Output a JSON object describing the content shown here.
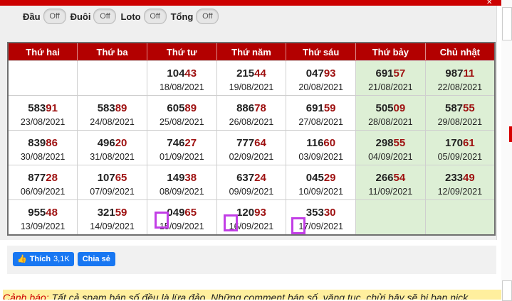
{
  "toggles": [
    {
      "label": "Đầu",
      "state": "Off"
    },
    {
      "label": "Đuôi",
      "state": "Off"
    },
    {
      "label": "Loto",
      "state": "Off"
    },
    {
      "label": "Tổng",
      "state": "Off"
    }
  ],
  "calendar": {
    "headers": [
      "Thứ hai",
      "Thứ ba",
      "Thứ tư",
      "Thứ năm",
      "Thứ sáu",
      "Thứ bảy",
      "Chủ nhật"
    ],
    "rows": [
      [
        {
          "head": "",
          "tail": "",
          "date": ""
        },
        {
          "head": "",
          "tail": "",
          "date": ""
        },
        {
          "head": "104",
          "tail": "43",
          "date": "18/08/2021"
        },
        {
          "head": "215",
          "tail": "44",
          "date": "19/08/2021"
        },
        {
          "head": "047",
          "tail": "93",
          "date": "20/08/2021"
        },
        {
          "head": "691",
          "tail": "57",
          "date": "21/08/2021"
        },
        {
          "head": "987",
          "tail": "11",
          "date": "22/08/2021"
        }
      ],
      [
        {
          "head": "583",
          "tail": "91",
          "date": "23/08/2021"
        },
        {
          "head": "583",
          "tail": "89",
          "date": "24/08/2021"
        },
        {
          "head": "605",
          "tail": "89",
          "date": "25/08/2021"
        },
        {
          "head": "886",
          "tail": "78",
          "date": "26/08/2021"
        },
        {
          "head": "691",
          "tail": "59",
          "date": "27/08/2021"
        },
        {
          "head": "505",
          "tail": "09",
          "date": "28/08/2021"
        },
        {
          "head": "587",
          "tail": "55",
          "date": "29/08/2021"
        }
      ],
      [
        {
          "head": "839",
          "tail": "86",
          "date": "30/08/2021"
        },
        {
          "head": "496",
          "tail": "20",
          "date": "31/08/2021"
        },
        {
          "head": "746",
          "tail": "27",
          "date": "01/09/2021"
        },
        {
          "head": "777",
          "tail": "64",
          "date": "02/09/2021"
        },
        {
          "head": "116",
          "tail": "60",
          "date": "03/09/2021"
        },
        {
          "head": "298",
          "tail": "55",
          "date": "04/09/2021"
        },
        {
          "head": "170",
          "tail": "61",
          "date": "05/09/2021"
        }
      ],
      [
        {
          "head": "877",
          "tail": "28",
          "date": "06/09/2021"
        },
        {
          "head": "107",
          "tail": "65",
          "date": "07/09/2021"
        },
        {
          "head": "149",
          "tail": "38",
          "date": "08/09/2021"
        },
        {
          "head": "637",
          "tail": "24",
          "date": "09/09/2021"
        },
        {
          "head": "045",
          "tail": "29",
          "date": "10/09/2021"
        },
        {
          "head": "266",
          "tail": "54",
          "date": "11/09/2021"
        },
        {
          "head": "233",
          "tail": "49",
          "date": "12/09/2021"
        }
      ],
      [
        {
          "head": "955",
          "tail": "48",
          "date": "13/09/2021"
        },
        {
          "head": "321",
          "tail": "59",
          "date": "14/09/2021"
        },
        {
          "head": "049",
          "tail": "65",
          "date": "15/09/2021"
        },
        {
          "head": "120",
          "tail": "93",
          "date": "16/09/2021"
        },
        {
          "head": "353",
          "tail": "30",
          "date": "17/09/2021"
        },
        {
          "head": "",
          "tail": "",
          "date": ""
        },
        {
          "head": "",
          "tail": "",
          "date": ""
        }
      ]
    ]
  },
  "social": {
    "like_label": "Thích",
    "like_count": "3,1K",
    "share_label": "Chia sẻ"
  },
  "warning": {
    "label": "Cảnh báo:",
    "text": " Tất cả spam bán số đều là lừa đảo. Những comment bán số, văng tục, chửi bậy sẽ bị ban nick."
  },
  "colors": {
    "header_bg": "#b30000",
    "weekend_bg": "#ddefd5",
    "tail_digits": "#9e1010",
    "highlight": "#c23ee6"
  }
}
